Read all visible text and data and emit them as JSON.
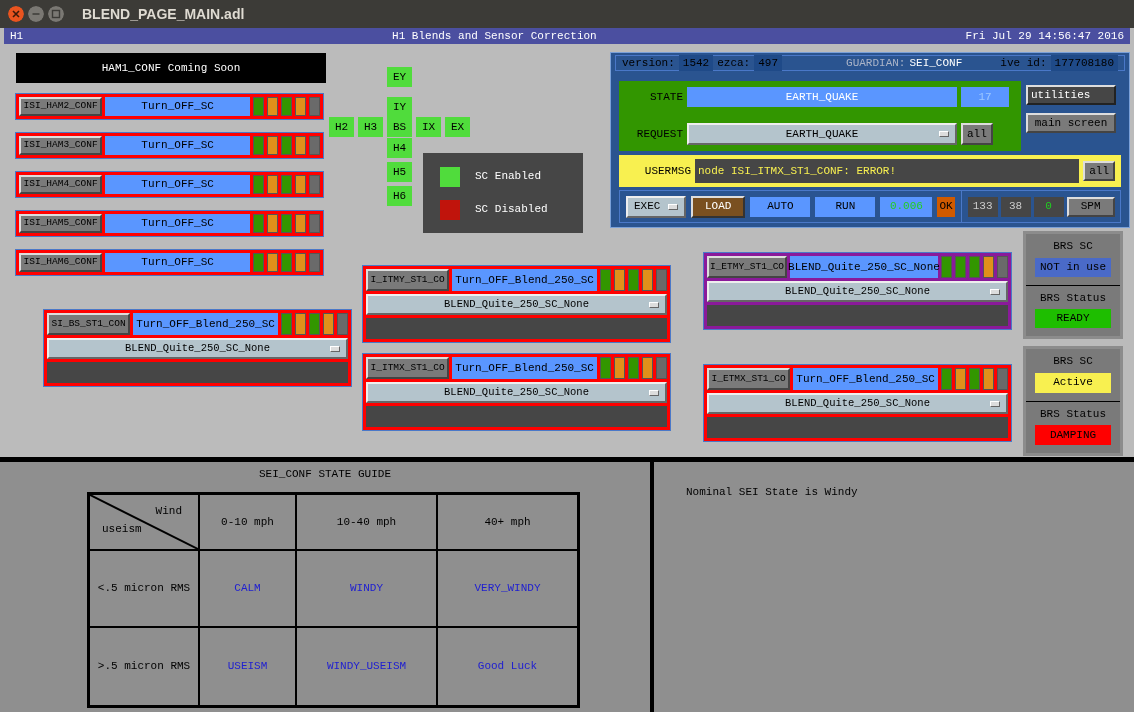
{
  "window": {
    "title": "BLEND_PAGE_MAIN.adl"
  },
  "header": {
    "site": "H1",
    "title": "H1 Blends and Sensor Correction",
    "datetime": "Fri Jul 29 14:56:47 2016"
  },
  "banner": "HAM1_CONF Coming Soon",
  "ham_rows": [
    {
      "node": "ISI_HAM2_CONF",
      "state": "Turn_OFF_SC",
      "leds": [
        {
          "color": "#329600"
        },
        {
          "color": "#e0901a"
        },
        {
          "color": "#329600"
        },
        {
          "color": "#e0901a"
        },
        {
          "color": "#6a6a6a"
        }
      ]
    },
    {
      "node": "ISI_HAM3_CONF",
      "state": "Turn_OFF_SC",
      "leds": [
        {
          "color": "#329600"
        },
        {
          "color": "#e0901a"
        },
        {
          "color": "#329600"
        },
        {
          "color": "#e0901a"
        },
        {
          "color": "#6a6a6a"
        }
      ]
    },
    {
      "node": "ISI_HAM4_CONF",
      "state": "Turn_OFF_SC",
      "leds": [
        {
          "color": "#329600"
        },
        {
          "color": "#e0901a"
        },
        {
          "color": "#329600"
        },
        {
          "color": "#e0901a"
        },
        {
          "color": "#6a6a6a"
        }
      ]
    },
    {
      "node": "ISI_HAM5_CONF",
      "state": "Turn_OFF_SC",
      "leds": [
        {
          "color": "#329600"
        },
        {
          "color": "#e0901a"
        },
        {
          "color": "#329600"
        },
        {
          "color": "#e0901a"
        },
        {
          "color": "#6a6a6a"
        }
      ]
    },
    {
      "node": "ISI_HAM6_CONF",
      "state": "Turn_OFF_SC",
      "leds": [
        {
          "color": "#329600"
        },
        {
          "color": "#e0901a"
        },
        {
          "color": "#329600"
        },
        {
          "color": "#e0901a"
        },
        {
          "color": "#6a6a6a"
        }
      ]
    }
  ],
  "chambers": [
    {
      "label": "EY"
    },
    {
      "label": "IY"
    },
    {
      "label": "H2"
    },
    {
      "label": "H3"
    },
    {
      "label": "BS"
    },
    {
      "label": "IX"
    },
    {
      "label": "EX"
    },
    {
      "label": "H4"
    },
    {
      "label": "H5"
    },
    {
      "label": "H6"
    }
  ],
  "legend": [
    {
      "label": "SC Enabled",
      "color": "#50dc3c"
    },
    {
      "label": "SC Disabled",
      "color": "#c0140c"
    }
  ],
  "guardian": {
    "version_label": "version:",
    "version": "1542",
    "ezca_label": "ezca:",
    "ezca": "497",
    "guardian_label": "GUARDIAN:",
    "node": "SEI_CONF",
    "ive_label": "ive id:",
    "ive_id": "177708180",
    "state_label": "STATE",
    "state": "EARTH_QUAKE",
    "state_index": "17",
    "request_label": "REQUEST",
    "request": "EARTH_QUAKE",
    "request_all": "all",
    "usermsg_label": "USERMSG",
    "usermsg": "node ISI_ITMX_ST1_CONF: ERROR!",
    "usermsg_all": "all",
    "utilities": "utilities",
    "main_screen": "main screen",
    "controls": [
      {
        "kind": "menu",
        "label": "EXEC"
      },
      {
        "kind": "button",
        "label": "LOAD"
      },
      {
        "kind": "readout",
        "label": "AUTO"
      },
      {
        "kind": "readout",
        "label": "RUN"
      },
      {
        "kind": "value",
        "label": "0.006"
      },
      {
        "kind": "flag",
        "label": "OK"
      }
    ],
    "counters": [
      {
        "label": "133"
      },
      {
        "label": "38"
      },
      {
        "label": "0"
      }
    ],
    "spm": "SPM"
  },
  "st1_panels": [
    {
      "node": "SI_BS_ST1_CON",
      "state": "Turn_OFF_Blend_250_SC",
      "request": "BLEND_Quite_250_SC_None",
      "color": "#ff0000",
      "leds": [
        {
          "color": "#329600"
        },
        {
          "color": "#e0901a"
        },
        {
          "color": "#329600"
        },
        {
          "color": "#e0901a"
        },
        {
          "color": "#6a6a6a"
        }
      ]
    },
    {
      "node": "I_ITMY_ST1_CO",
      "state": "Turn_OFF_Blend_250_SC",
      "request": "BLEND_Quite_250_SC_None",
      "color": "#ff0000",
      "leds": [
        {
          "color": "#329600"
        },
        {
          "color": "#e0901a"
        },
        {
          "color": "#329600"
        },
        {
          "color": "#e0901a"
        },
        {
          "color": "#6a6a6a"
        }
      ]
    },
    {
      "node": "I_ITMX_ST1_CO",
      "state": "Turn_OFF_Blend_250_SC",
      "request": "BLEND_Quite_250_SC_None",
      "color": "#ff0000",
      "leds": [
        {
          "color": "#329600"
        },
        {
          "color": "#e0901a"
        },
        {
          "color": "#329600"
        },
        {
          "color": "#e0901a"
        },
        {
          "color": "#6a6a6a"
        }
      ]
    },
    {
      "node": "I_ETMY_ST1_CO",
      "state": "BLEND_Quite_250_SC_None",
      "request": "BLEND_Quite_250_SC_None",
      "color": "#8a1a9a",
      "leds": [
        {
          "color": "#329600"
        },
        {
          "color": "#329600"
        },
        {
          "color": "#329600"
        },
        {
          "color": "#e0901a"
        },
        {
          "color": "#6a6a6a"
        }
      ]
    },
    {
      "node": "I_ETMX_ST1_CO",
      "state": "Turn_OFF_Blend_250_SC",
      "request": "BLEND_Quite_250_SC_None",
      "color": "#ff0000",
      "leds": [
        {
          "color": "#329600"
        },
        {
          "color": "#e0901a"
        },
        {
          "color": "#329600"
        },
        {
          "color": "#e0901a"
        },
        {
          "color": "#6a6a6a"
        }
      ]
    }
  ],
  "brs": [
    {
      "sc_label": "BRS SC",
      "sc": {
        "text": "NOT in use",
        "color": "#4a6ac8"
      },
      "status_label": "BRS Status",
      "status": {
        "text": "READY",
        "color": "#1ebe00"
      }
    },
    {
      "sc_label": "BRS SC",
      "sc": {
        "text": "Active",
        "color": "#f8f050"
      },
      "status_label": "BRS Status",
      "status": {
        "text": "DAMPING",
        "color": "#ff0000"
      }
    }
  ],
  "state_guide": {
    "title": "SEI_CONF STATE GUIDE",
    "corner_top": "Wind",
    "corner_bottom": "useism",
    "columns": [
      "0-10 mph",
      "10-40 mph",
      "40+ mph"
    ],
    "rows": [
      {
        "label": "<.5 micron RMS",
        "cells": [
          "CALM",
          "WINDY",
          "VERY_WINDY"
        ]
      },
      {
        "label": ">.5 micron RMS",
        "cells": [
          "USEISM",
          "WINDY_USEISM",
          "Good Luck"
        ]
      }
    ]
  },
  "note": "Nominal SEI State is Windy"
}
